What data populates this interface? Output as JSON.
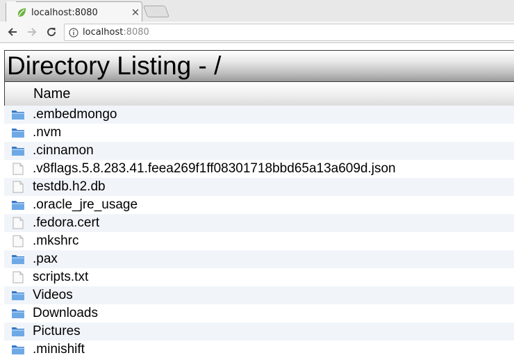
{
  "browser": {
    "tab_title": "localhost:8080",
    "tab_close": "✕",
    "url_host": "localhost",
    "url_port": ":8080"
  },
  "page": {
    "heading": "Directory Listing - /",
    "column_name": "Name"
  },
  "entries": [
    {
      "name": ".embedmongo",
      "type": "folder"
    },
    {
      "name": ".nvm",
      "type": "folder"
    },
    {
      "name": ".cinnamon",
      "type": "folder"
    },
    {
      "name": ".v8flags.5.8.283.41.feea269f1ff08301718bbd65a13a609d.json",
      "type": "file"
    },
    {
      "name": "testdb.h2.db",
      "type": "file"
    },
    {
      "name": ".oracle_jre_usage",
      "type": "folder"
    },
    {
      "name": ".fedora.cert",
      "type": "file"
    },
    {
      "name": ".mkshrc",
      "type": "file"
    },
    {
      "name": ".pax",
      "type": "folder"
    },
    {
      "name": "scripts.txt",
      "type": "file"
    },
    {
      "name": "Videos",
      "type": "folder"
    },
    {
      "name": "Downloads",
      "type": "folder"
    },
    {
      "name": "Pictures",
      "type": "folder"
    },
    {
      "name": ".minishift",
      "type": "folder"
    }
  ],
  "colors": {
    "row_alt": "#f1f5fa",
    "folder_blue": "#4a90d9",
    "favicon_green": "#6db33f"
  }
}
